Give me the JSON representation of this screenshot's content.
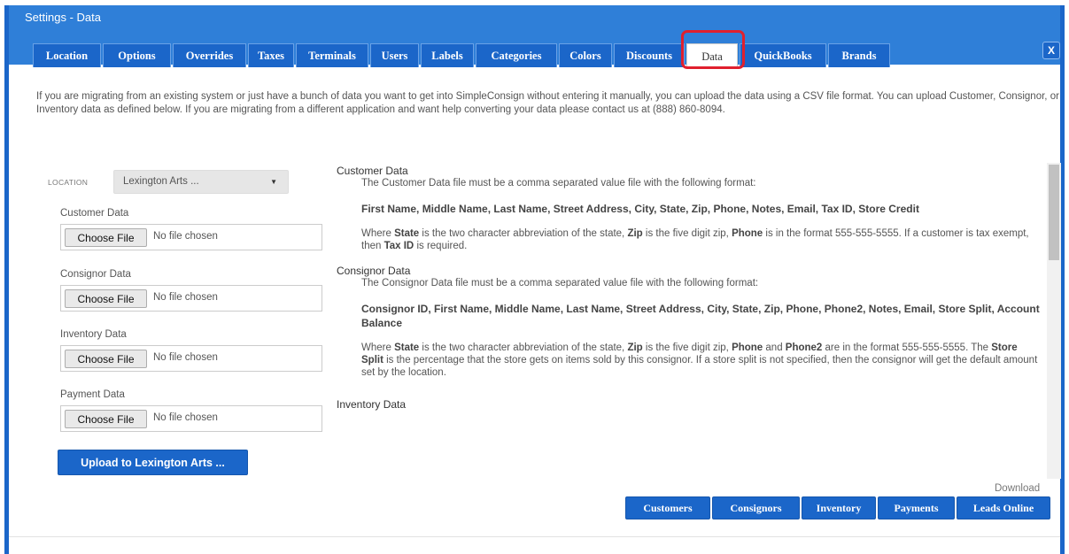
{
  "window": {
    "title": "Settings - Data"
  },
  "tabs": [
    {
      "label": "Location"
    },
    {
      "label": "Options"
    },
    {
      "label": "Overrides"
    },
    {
      "label": "Taxes"
    },
    {
      "label": "Terminals"
    },
    {
      "label": "Users"
    },
    {
      "label": "Labels"
    },
    {
      "label": "Categories"
    },
    {
      "label": "Colors"
    },
    {
      "label": "Discounts"
    },
    {
      "label": "Data",
      "active": true
    },
    {
      "label": "QuickBooks"
    },
    {
      "label": "Brands"
    }
  ],
  "close_label": "X",
  "intro": "If you are migrating from an existing system or just have a bunch of data you want to get into SimpleConsign without entering it manually, you can upload the data using a CSV file format. You can upload Customer, Consignor, or Inventory data as defined below. If you are migrating from a different application and want help converting your data please contact us at (888) 860-8094.",
  "location": {
    "label": "LOCATION",
    "selected": "Lexington Arts ..."
  },
  "uploads": [
    {
      "label": "Customer Data",
      "button": "Choose File",
      "status": "No file chosen"
    },
    {
      "label": "Consignor Data",
      "button": "Choose File",
      "status": "No file chosen"
    },
    {
      "label": "Inventory Data",
      "button": "Choose File",
      "status": "No file chosen"
    },
    {
      "label": "Payment Data",
      "button": "Choose File",
      "status": "No file chosen"
    }
  ],
  "upload_button": "Upload to Lexington Arts ...",
  "sections": {
    "customer": {
      "title": "Customer Data",
      "desc": "The Customer Data file must be a comma separated value file with the following format:",
      "format": "First Name, Middle Name, Last Name, Street Address, City, State, Zip, Phone, Notes, Email, Tax ID, Store Credit",
      "note_1": "Where ",
      "note_state": "State",
      "note_2": " is the two character abbreviation of the state, ",
      "note_zip": "Zip",
      "note_3": " is the five digit zip, ",
      "note_phone": "Phone",
      "note_4": " is in the format 555-555-5555. If a customer is tax exempt, then ",
      "note_taxid": "Tax ID",
      "note_5": " is required."
    },
    "consignor": {
      "title": "Consignor Data",
      "desc": "The Consignor Data file must be a comma separated value file with the following format:",
      "format": "Consignor ID, First Name, Middle Name, Last Name, Street Address, City, State, Zip, Phone, Phone2, Notes, Email, Store Split, Account Balance",
      "note_1": "Where ",
      "note_state": "State",
      "note_2": " is the two character abbreviation of the state, ",
      "note_zip": "Zip",
      "note_3": " is the five digit zip, ",
      "note_phone": "Phone",
      "note_and": " and ",
      "note_phone2": "Phone2",
      "note_4": " are in the format 555-555-5555. The ",
      "note_split": "Store Split",
      "note_5": " is the percentage that the store gets on items sold by this consignor. If a store split is not specified, then the consignor will get the default amount set by the location."
    },
    "inventory": {
      "title": "Inventory Data"
    }
  },
  "download": {
    "label": "Download",
    "buttons": [
      "Customers",
      "Consignors",
      "Inventory",
      "Payments",
      "Leads Online"
    ]
  }
}
